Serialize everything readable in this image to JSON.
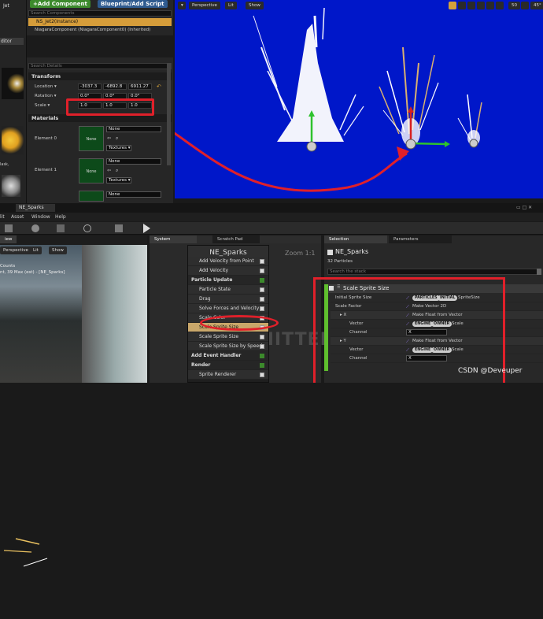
{
  "details": {
    "left_tab_fragment": "Jet",
    "left_tab_fragment2": "ditor",
    "left_tab_fragment3": "lask,",
    "add_component": "+Add Component",
    "blueprint": "Blueprint/Add Script",
    "search_components": "Search Components",
    "component_root": "NS_Jet2(Instance)",
    "component_child": "NiagaraComponent (NiagaraComponent0) (Inherited)",
    "search_details": "Search Details",
    "transform_hdr": "Transform",
    "location_label": "Location ▾",
    "rotation_label": "Rotation ▾",
    "scale_label": "Scale ▾",
    "location_values": [
      "-3037.3",
      "-6892.8",
      "6911.27"
    ],
    "rotation_values": [
      "0.0°",
      "0.0°",
      "0.0°"
    ],
    "scale_values": [
      "1.0",
      "1.0",
      "1.0"
    ],
    "materials_hdr": "Materials",
    "element0": "Element 0",
    "element1": "Element 1",
    "none": "None",
    "textures": "Textures ▾"
  },
  "viewport": {
    "perspective": "Perspective",
    "lit": "Lit",
    "show": "Show",
    "fov": "50",
    "angle": "45°",
    "scale_val": "1"
  },
  "menu": {
    "tab_title": "NE_Sparks",
    "items": [
      "lit",
      "Asset",
      "Window",
      "Help"
    ]
  },
  "preview": {
    "tab": "iew",
    "perspective": "Perspective",
    "lit": "Lit",
    "show": "Show",
    "counts": "Counts",
    "counts2": "nt, 39 Max (est) - [NE_Sparks]"
  },
  "system": {
    "tab1": "System Overview",
    "tab2": "Scratch Pad",
    "zoom": "Zoom 1:1",
    "node_title": "NE_Sparks",
    "watermark": "EMITTER",
    "rows": [
      {
        "label": "Add Velocity from Point",
        "bold": false
      },
      {
        "label": "Add Velocity",
        "bold": false
      },
      {
        "label": "Particle Update",
        "bold": true
      },
      {
        "label": "Particle State",
        "bold": false
      },
      {
        "label": "Drag",
        "bold": false
      },
      {
        "label": "Solve Forces and Velocity",
        "bold": false
      },
      {
        "label": "Scale Color",
        "bold": false
      },
      {
        "label": "Scale Sprite Size",
        "bold": false
      },
      {
        "label": "Scale Sprite Size",
        "bold": false
      },
      {
        "label": "Scale Sprite Size by Speed",
        "bold": false
      },
      {
        "label": "Add Event Handler",
        "bold": true
      },
      {
        "label": "Render",
        "bold": true
      },
      {
        "label": "Sprite Renderer",
        "bold": false
      }
    ],
    "spawn_partial": "Sphere Location"
  },
  "selection": {
    "tab1": "Selection",
    "tab2": "Parameters",
    "title": "NE_Sparks",
    "particles": "32 Particles",
    "search": "Search the stack",
    "module": "Scale Sprite Size",
    "initial_label": "Initial Sprite Size",
    "pill_particles": "PARTICLES",
    "pill_initial": "INITIAL",
    "sprite_size": "SpriteSize",
    "scale_factor": "Scale Factor",
    "make_vector": "Make Vector 2D",
    "x_label": "▸ X",
    "make_float": "Make Float from Vector",
    "vector_label": "Vector",
    "pill_engine": "ENGINE",
    "pill_owner": "OWNER",
    "scale_word": "Scale",
    "channel_label": "Channel",
    "channel_x": "X",
    "y_label": "▸ Y",
    "make_float_y": "Make Float from Vector",
    "channel_x2": "X"
  },
  "watermark": "CSDN @Deveuper"
}
